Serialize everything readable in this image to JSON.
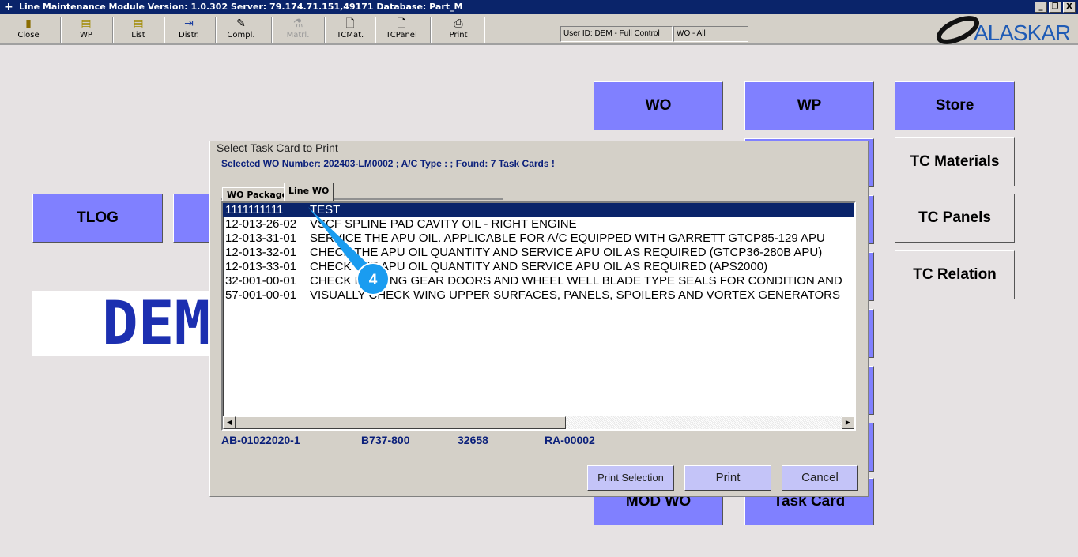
{
  "window": {
    "title": "Line Maintenance Module  Version: 1.0.302 Server: 79.174.71.151,49171 Database: Part_M",
    "controls": [
      "_",
      "ᴒ",
      "X"
    ]
  },
  "toolbar": [
    {
      "label": "Close",
      "icon": "door-exit-icon",
      "glyph": "🚪"
    },
    {
      "label": "WP",
      "icon": "printer-doc-icon",
      "glyph": "▤"
    },
    {
      "label": "List",
      "icon": "list-doc-icon",
      "glyph": "▤"
    },
    {
      "label": "Distr.",
      "icon": "distribute-icon",
      "glyph": "⇥"
    },
    {
      "label": "Compl.",
      "icon": "complete-icon",
      "glyph": "✎"
    },
    {
      "label": "Matrl.",
      "icon": "flask-icon",
      "glyph": "⚗",
      "disabled": true
    },
    {
      "label": "TCMat.",
      "icon": "document-icon",
      "glyph": "🗋"
    },
    {
      "label": "TCPanel",
      "icon": "document-icon",
      "glyph": "🗋"
    },
    {
      "label": "Print",
      "icon": "printer-icon",
      "glyph": "⎙"
    }
  ],
  "status": {
    "user": "User ID: DEM - Full Control",
    "wo": "WO - All"
  },
  "logo": "ALASKAR",
  "background": {
    "wo": "WO",
    "wp": "WP",
    "store": "Store",
    "tc_materials": "TC Materials",
    "tc_panels": "TC Panels",
    "tc_relation": "TC Relation",
    "tlog": "TLOG",
    "mod_wo": "MOD WO",
    "task_card": "Task Card",
    "dem": "DEM"
  },
  "dialog": {
    "title": "Select Task Card to Print",
    "info": "Selected WO Number: 202403-LM0002 ;  A/C Type : ; Found: 7 Task Cards !",
    "tabs": [
      "WO Package",
      "Line WO"
    ],
    "rows": [
      {
        "code": "1111111111",
        "desc": "TEST"
      },
      {
        "code": "12-013-26-02",
        "desc": "VSCF SPLINE PAD CAVITY OIL - RIGHT ENGINE"
      },
      {
        "code": "12-013-31-01",
        "desc": "SERVICE THE APU OIL. APPLICABLE FOR A/C EQUIPPED WITH GARRETT GTCP85-129 APU"
      },
      {
        "code": "12-013-32-01",
        "desc": "CHECK THE APU OIL QUANTITY AND SERVICE APU OIL AS REQUIRED (GTCP36-280B APU)"
      },
      {
        "code": "12-013-33-01",
        "desc": "CHECK THE APU OIL QUANTITY AND SERVICE APU OIL AS REQUIRED (APS2000)"
      },
      {
        "code": "32-001-00-01",
        "desc": "CHECK LANDING GEAR DOORS AND WHEEL WELL BLADE TYPE SEALS FOR CONDITION AND"
      },
      {
        "code": "57-001-00-01",
        "desc": "VISUALLY CHECK WING UPPER SURFACES, PANELS, SPOILERS AND VORTEX GENERATORS"
      }
    ],
    "details": [
      "AB-01022020-1",
      "B737-800",
      "32658",
      "RA-00002"
    ],
    "buttons": {
      "print_selection": "Print Selection",
      "print": "Print",
      "cancel": "Cancel"
    }
  },
  "callout": {
    "step": "4",
    "color": "#1a9cf0"
  }
}
